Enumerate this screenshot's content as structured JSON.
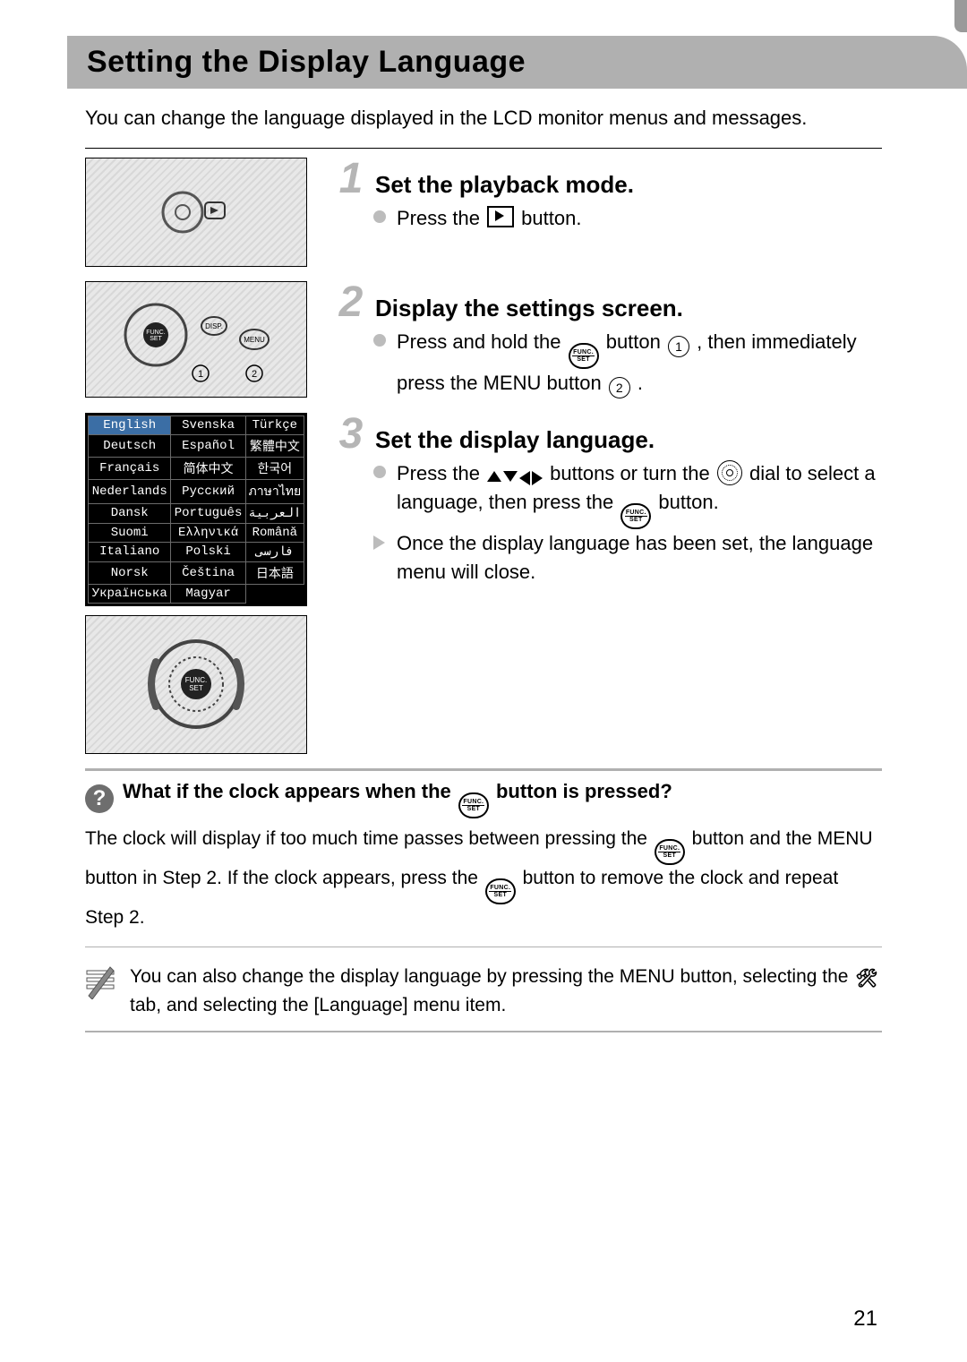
{
  "page_number": "21",
  "title": "Setting the Display Language",
  "intro": "You can change the language displayed in the LCD monitor menus and messages.",
  "steps": {
    "s1": {
      "num": "1",
      "heading": "Set the playback mode.",
      "b1a": "Press the ",
      "b1b": " button."
    },
    "s2": {
      "num": "2",
      "heading": "Display the settings screen.",
      "b1a": "Press and hold the ",
      "b1b": " button ",
      "b1c": ", then immediately press the ",
      "menu": "MENU",
      "b1d": " button ",
      "b1e": "."
    },
    "s3": {
      "num": "3",
      "heading": "Set the display language.",
      "b1a": "Press the ",
      "b1b": " buttons or turn the ",
      "b1c": " dial to select a language, then press the ",
      "b1d": " button.",
      "t1": "Once the display language has been set, the language menu will close."
    }
  },
  "circ1": "1",
  "circ2": "2",
  "funclabel_top": "FUNC.",
  "funclabel_bot": "SET",
  "languages": [
    [
      "English",
      "Svenska",
      "Türkçe"
    ],
    [
      "Deutsch",
      "Español",
      "繁體中文"
    ],
    [
      "Français",
      "简体中文",
      "한국어"
    ],
    [
      "Nederlands",
      "Русский",
      "ภาษาไทย"
    ],
    [
      "Dansk",
      "Português",
      "العربية"
    ],
    [
      "Suomi",
      "Ελληνικά",
      "Română"
    ],
    [
      "Italiano",
      "Polski",
      "فارسی"
    ],
    [
      "Norsk",
      "Čeština",
      "日本語"
    ],
    [
      "Українська",
      "Magyar",
      ""
    ]
  ],
  "selected_language": "English",
  "question": {
    "head_a": "What if the clock appears when the ",
    "head_b": " button is pressed?",
    "body_a": "The clock will display if too much time passes between pressing the ",
    "body_b": " button and the ",
    "menu": "MENU",
    "body_c": " button in Step 2. If the clock appears, press the ",
    "body_d": " button to remove the clock and repeat Step 2."
  },
  "note": {
    "a": "You can also change the display language by pressing the ",
    "menu": "MENU",
    "b": " button, selecting the ",
    "c": " tab, and selecting the [Language] menu item."
  }
}
